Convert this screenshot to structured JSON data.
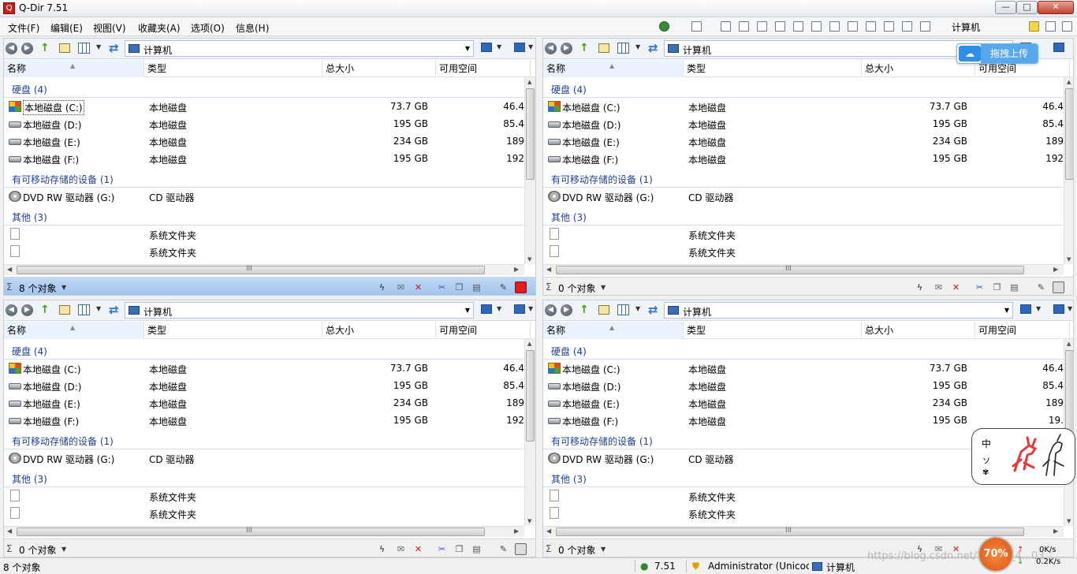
{
  "window": {
    "title": "Q-Dir 7.51"
  },
  "menu": [
    "文件(F)",
    "编辑(E)",
    "视图(V)",
    "收藏夹(A)",
    "选项(O)",
    "信息(H)"
  ],
  "toolbar": {
    "location": "计算机"
  },
  "address": "计算机",
  "columns": {
    "name": "名称",
    "type": "类型",
    "size": "总大小",
    "free": "可用空间"
  },
  "groups": {
    "hdd": "硬盘 (4)",
    "removable": "有可移动存储的设备 (1)",
    "other": "其他 (3)"
  },
  "drives": [
    {
      "name": "本地磁盘 (C:)",
      "type": "本地磁盘",
      "size": "73.7 GB",
      "free": "46.4",
      "icon": "windows-drive-icon"
    },
    {
      "name": "本地磁盘 (D:)",
      "type": "本地磁盘",
      "size": "195 GB",
      "free": "85.4",
      "icon": "hard-drive-icon"
    },
    {
      "name": "本地磁盘 (E:)",
      "type": "本地磁盘",
      "size": "234 GB",
      "free": "189",
      "icon": "hard-drive-icon"
    },
    {
      "name": "本地磁盘 (F:)",
      "type": "本地磁盘",
      "size": "195 GB",
      "free": "192",
      "icon": "hard-drive-icon"
    }
  ],
  "removable": [
    {
      "name": "DVD RW 驱动器 (G:)",
      "type": "CD 驱动器",
      "icon": "dvd-drive-icon"
    }
  ],
  "other": [
    {
      "name": "",
      "type": "系统文件夹",
      "icon": "file-icon"
    },
    {
      "name": "",
      "type": "系统文件夹",
      "icon": "file-icon"
    }
  ],
  "panes": [
    {
      "id": "tl",
      "count": "8 个对象",
      "active": true,
      "free_c": "46.4",
      "free_f": "192"
    },
    {
      "id": "tr",
      "count": "0 个对象",
      "active": false,
      "free_c": "46.4",
      "free_f": "192"
    },
    {
      "id": "bl",
      "count": "0 个对象",
      "active": false,
      "free_c": "46.4",
      "free_f": "192"
    },
    {
      "id": "br",
      "count": "0 个对象",
      "active": false,
      "free_c": "46.4",
      "free_f": "19."
    }
  ],
  "scroll_mark": "III",
  "status": {
    "left": "8 个对象",
    "version": "7.51",
    "user": "Administrator (Unicoc",
    "location": "计算机"
  },
  "upload": {
    "label": "拖拽上传"
  },
  "sticker": {
    "chars": [
      "中",
      "ソ",
      "✾"
    ]
  },
  "network": {
    "percent": "70%",
    "up": "0K/s",
    "down": "0.2K/s"
  },
  "watermark": "https://blog.csdn.net/weixin_4...03"
}
